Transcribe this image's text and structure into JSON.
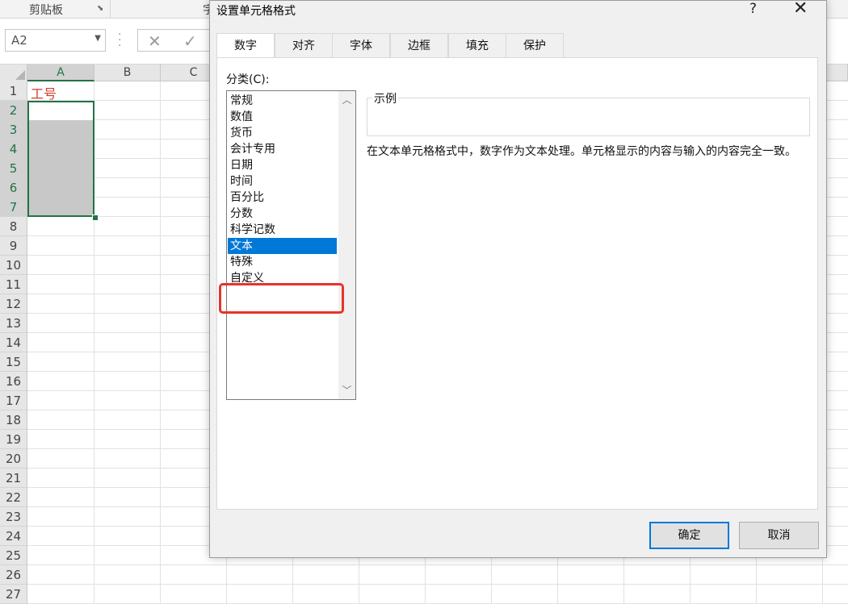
{
  "ribbon": {
    "clipboard_label": "剪贴板",
    "font_group_label": "字"
  },
  "formula_bar": {
    "name_box": "A2"
  },
  "sheet": {
    "columns": [
      "A",
      "B",
      "C"
    ],
    "rows": [
      "1",
      "2",
      "3",
      "4",
      "5",
      "6",
      "7",
      "8",
      "9",
      "10",
      "11",
      "12",
      "13",
      "14",
      "15",
      "16",
      "17",
      "18",
      "19",
      "20",
      "21",
      "22",
      "23",
      "24",
      "25",
      "26",
      "27"
    ],
    "cell_a1": "工号",
    "cell_a1_color": "#d63b2f",
    "selection_color": "#217346"
  },
  "dialog": {
    "title": "设置单元格格式",
    "help_label": "?",
    "tabs": [
      {
        "label": "数字",
        "active": true
      },
      {
        "label": "对齐",
        "active": false
      },
      {
        "label": "字体",
        "active": false
      },
      {
        "label": "边框",
        "active": false
      },
      {
        "label": "填充",
        "active": false
      },
      {
        "label": "保护",
        "active": false
      }
    ],
    "category_label": "分类(C):",
    "categories": [
      "常规",
      "数值",
      "货币",
      "会计专用",
      "日期",
      "时间",
      "百分比",
      "分数",
      "科学记数",
      "文本",
      "特殊",
      "自定义"
    ],
    "selected_category": "文本",
    "selected_color": "#0078d7",
    "highlight_color": "#e8332a",
    "sample_label": "示例",
    "description": "在文本单元格格式中，数字作为文本处理。单元格显示的内容与输入的内容完全一致。",
    "ok_label": "确定",
    "cancel_label": "取消"
  }
}
